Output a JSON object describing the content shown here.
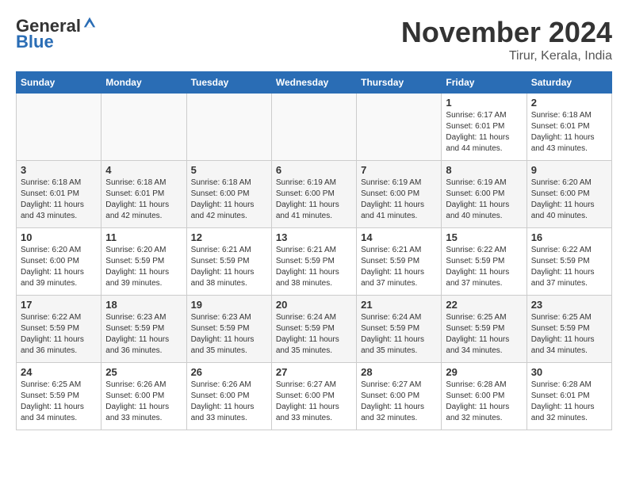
{
  "logo": {
    "general": "General",
    "blue": "Blue"
  },
  "title": "November 2024",
  "location": "Tirur, Kerala, India",
  "days_of_week": [
    "Sunday",
    "Monday",
    "Tuesday",
    "Wednesday",
    "Thursday",
    "Friday",
    "Saturday"
  ],
  "weeks": [
    [
      {
        "day": "",
        "info": ""
      },
      {
        "day": "",
        "info": ""
      },
      {
        "day": "",
        "info": ""
      },
      {
        "day": "",
        "info": ""
      },
      {
        "day": "",
        "info": ""
      },
      {
        "day": "1",
        "info": "Sunrise: 6:17 AM\nSunset: 6:01 PM\nDaylight: 11 hours and 44 minutes."
      },
      {
        "day": "2",
        "info": "Sunrise: 6:18 AM\nSunset: 6:01 PM\nDaylight: 11 hours and 43 minutes."
      }
    ],
    [
      {
        "day": "3",
        "info": "Sunrise: 6:18 AM\nSunset: 6:01 PM\nDaylight: 11 hours and 43 minutes."
      },
      {
        "day": "4",
        "info": "Sunrise: 6:18 AM\nSunset: 6:01 PM\nDaylight: 11 hours and 42 minutes."
      },
      {
        "day": "5",
        "info": "Sunrise: 6:18 AM\nSunset: 6:00 PM\nDaylight: 11 hours and 42 minutes."
      },
      {
        "day": "6",
        "info": "Sunrise: 6:19 AM\nSunset: 6:00 PM\nDaylight: 11 hours and 41 minutes."
      },
      {
        "day": "7",
        "info": "Sunrise: 6:19 AM\nSunset: 6:00 PM\nDaylight: 11 hours and 41 minutes."
      },
      {
        "day": "8",
        "info": "Sunrise: 6:19 AM\nSunset: 6:00 PM\nDaylight: 11 hours and 40 minutes."
      },
      {
        "day": "9",
        "info": "Sunrise: 6:20 AM\nSunset: 6:00 PM\nDaylight: 11 hours and 40 minutes."
      }
    ],
    [
      {
        "day": "10",
        "info": "Sunrise: 6:20 AM\nSunset: 6:00 PM\nDaylight: 11 hours and 39 minutes."
      },
      {
        "day": "11",
        "info": "Sunrise: 6:20 AM\nSunset: 5:59 PM\nDaylight: 11 hours and 39 minutes."
      },
      {
        "day": "12",
        "info": "Sunrise: 6:21 AM\nSunset: 5:59 PM\nDaylight: 11 hours and 38 minutes."
      },
      {
        "day": "13",
        "info": "Sunrise: 6:21 AM\nSunset: 5:59 PM\nDaylight: 11 hours and 38 minutes."
      },
      {
        "day": "14",
        "info": "Sunrise: 6:21 AM\nSunset: 5:59 PM\nDaylight: 11 hours and 37 minutes."
      },
      {
        "day": "15",
        "info": "Sunrise: 6:22 AM\nSunset: 5:59 PM\nDaylight: 11 hours and 37 minutes."
      },
      {
        "day": "16",
        "info": "Sunrise: 6:22 AM\nSunset: 5:59 PM\nDaylight: 11 hours and 37 minutes."
      }
    ],
    [
      {
        "day": "17",
        "info": "Sunrise: 6:22 AM\nSunset: 5:59 PM\nDaylight: 11 hours and 36 minutes."
      },
      {
        "day": "18",
        "info": "Sunrise: 6:23 AM\nSunset: 5:59 PM\nDaylight: 11 hours and 36 minutes."
      },
      {
        "day": "19",
        "info": "Sunrise: 6:23 AM\nSunset: 5:59 PM\nDaylight: 11 hours and 35 minutes."
      },
      {
        "day": "20",
        "info": "Sunrise: 6:24 AM\nSunset: 5:59 PM\nDaylight: 11 hours and 35 minutes."
      },
      {
        "day": "21",
        "info": "Sunrise: 6:24 AM\nSunset: 5:59 PM\nDaylight: 11 hours and 35 minutes."
      },
      {
        "day": "22",
        "info": "Sunrise: 6:25 AM\nSunset: 5:59 PM\nDaylight: 11 hours and 34 minutes."
      },
      {
        "day": "23",
        "info": "Sunrise: 6:25 AM\nSunset: 5:59 PM\nDaylight: 11 hours and 34 minutes."
      }
    ],
    [
      {
        "day": "24",
        "info": "Sunrise: 6:25 AM\nSunset: 5:59 PM\nDaylight: 11 hours and 34 minutes."
      },
      {
        "day": "25",
        "info": "Sunrise: 6:26 AM\nSunset: 6:00 PM\nDaylight: 11 hours and 33 minutes."
      },
      {
        "day": "26",
        "info": "Sunrise: 6:26 AM\nSunset: 6:00 PM\nDaylight: 11 hours and 33 minutes."
      },
      {
        "day": "27",
        "info": "Sunrise: 6:27 AM\nSunset: 6:00 PM\nDaylight: 11 hours and 33 minutes."
      },
      {
        "day": "28",
        "info": "Sunrise: 6:27 AM\nSunset: 6:00 PM\nDaylight: 11 hours and 32 minutes."
      },
      {
        "day": "29",
        "info": "Sunrise: 6:28 AM\nSunset: 6:00 PM\nDaylight: 11 hours and 32 minutes."
      },
      {
        "day": "30",
        "info": "Sunrise: 6:28 AM\nSunset: 6:01 PM\nDaylight: 11 hours and 32 minutes."
      }
    ]
  ]
}
